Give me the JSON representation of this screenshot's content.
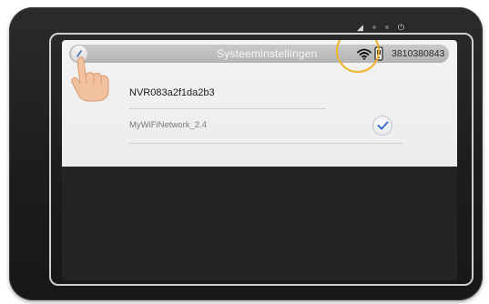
{
  "header": {
    "title": "Systeeminstellingen",
    "device_id": "3810380843",
    "back_icon": "back-arrow-icon",
    "wifi_icon": "wifi-icon",
    "phone_icon": "phone-icon"
  },
  "settings": {
    "device_name": "NVR083a2f1da2b3",
    "network_name": "MyWiFiNetwork_2.4",
    "network_selected": true
  },
  "status_indicators": [
    "signal-icon",
    "dot-icon",
    "dot-icon",
    "power-icon"
  ],
  "colors": {
    "highlight": "#f0b42a",
    "check": "#3a6fc4",
    "header": "#bcbcbc"
  }
}
